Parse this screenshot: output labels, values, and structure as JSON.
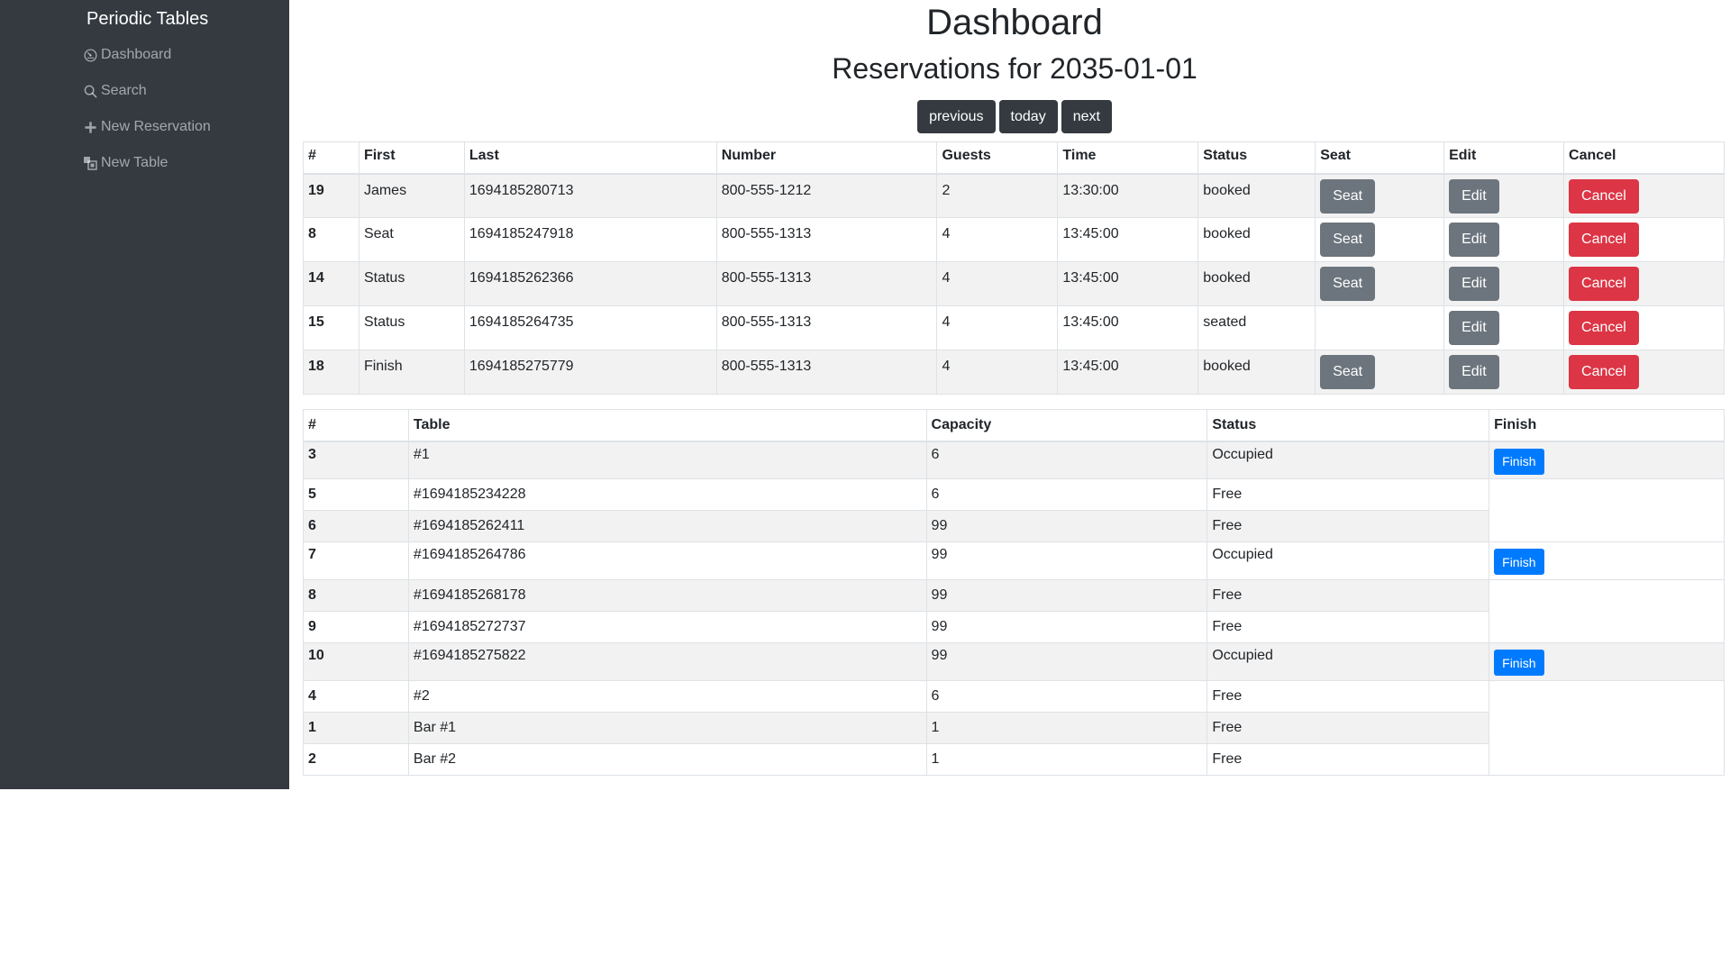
{
  "sidebar": {
    "brand": "Periodic Tables",
    "items": [
      {
        "label": "Dashboard",
        "icon": "dashboard-icon"
      },
      {
        "label": "Search",
        "icon": "search-icon"
      },
      {
        "label": "New Reservation",
        "icon": "plus-icon"
      },
      {
        "label": "New Table",
        "icon": "new-table-icon"
      }
    ]
  },
  "main": {
    "title": "Dashboard",
    "subtitle": "Reservations for 2035-01-01",
    "nav": {
      "previous": "previous",
      "today": "today",
      "next": "next"
    }
  },
  "reservations": {
    "headers": [
      "#",
      "First",
      "Last",
      "Number",
      "Guests",
      "Time",
      "Status",
      "Seat",
      "Edit",
      "Cancel"
    ],
    "seat_label": "Seat",
    "edit_label": "Edit",
    "cancel_label": "Cancel",
    "rows": [
      {
        "id": "19",
        "first": "James",
        "last": "1694185280713",
        "number": "800-555-1212",
        "guests": "2",
        "time": "13:30:00",
        "status": "booked",
        "seat": true
      },
      {
        "id": "8",
        "first": "Seat",
        "last": "1694185247918",
        "number": "800-555-1313",
        "guests": "4",
        "time": "13:45:00",
        "status": "booked",
        "seat": true
      },
      {
        "id": "14",
        "first": "Status",
        "last": "1694185262366",
        "number": "800-555-1313",
        "guests": "4",
        "time": "13:45:00",
        "status": "booked",
        "seat": true
      },
      {
        "id": "15",
        "first": "Status",
        "last": "1694185264735",
        "number": "800-555-1313",
        "guests": "4",
        "time": "13:45:00",
        "status": "seated",
        "seat": false
      },
      {
        "id": "18",
        "first": "Finish",
        "last": "1694185275779",
        "number": "800-555-1313",
        "guests": "4",
        "time": "13:45:00",
        "status": "booked",
        "seat": true
      }
    ]
  },
  "tables": {
    "headers": [
      "#",
      "Table",
      "Capacity",
      "Status",
      "Finish"
    ],
    "finish_label": "Finish",
    "rows": [
      {
        "id": "3",
        "name": "#1",
        "capacity": "6",
        "status": "Occupied"
      },
      {
        "id": "5",
        "name": "#1694185234228",
        "capacity": "6",
        "status": "Free"
      },
      {
        "id": "6",
        "name": "#1694185262411",
        "capacity": "99",
        "status": "Free"
      },
      {
        "id": "7",
        "name": "#1694185264786",
        "capacity": "99",
        "status": "Occupied"
      },
      {
        "id": "8",
        "name": "#1694185268178",
        "capacity": "99",
        "status": "Free"
      },
      {
        "id": "9",
        "name": "#1694185272737",
        "capacity": "99",
        "status": "Free"
      },
      {
        "id": "10",
        "name": "#1694185275822",
        "capacity": "99",
        "status": "Occupied"
      },
      {
        "id": "4",
        "name": "#2",
        "capacity": "6",
        "status": "Free"
      },
      {
        "id": "1",
        "name": "Bar #1",
        "capacity": "1",
        "status": "Free"
      },
      {
        "id": "2",
        "name": "Bar #2",
        "capacity": "1",
        "status": "Free"
      }
    ]
  },
  "colors": {
    "sidebar_bg": "#343a40",
    "primary": "#007bff",
    "secondary": "#6c757d",
    "danger": "#dc3545",
    "dark": "#343a40"
  }
}
